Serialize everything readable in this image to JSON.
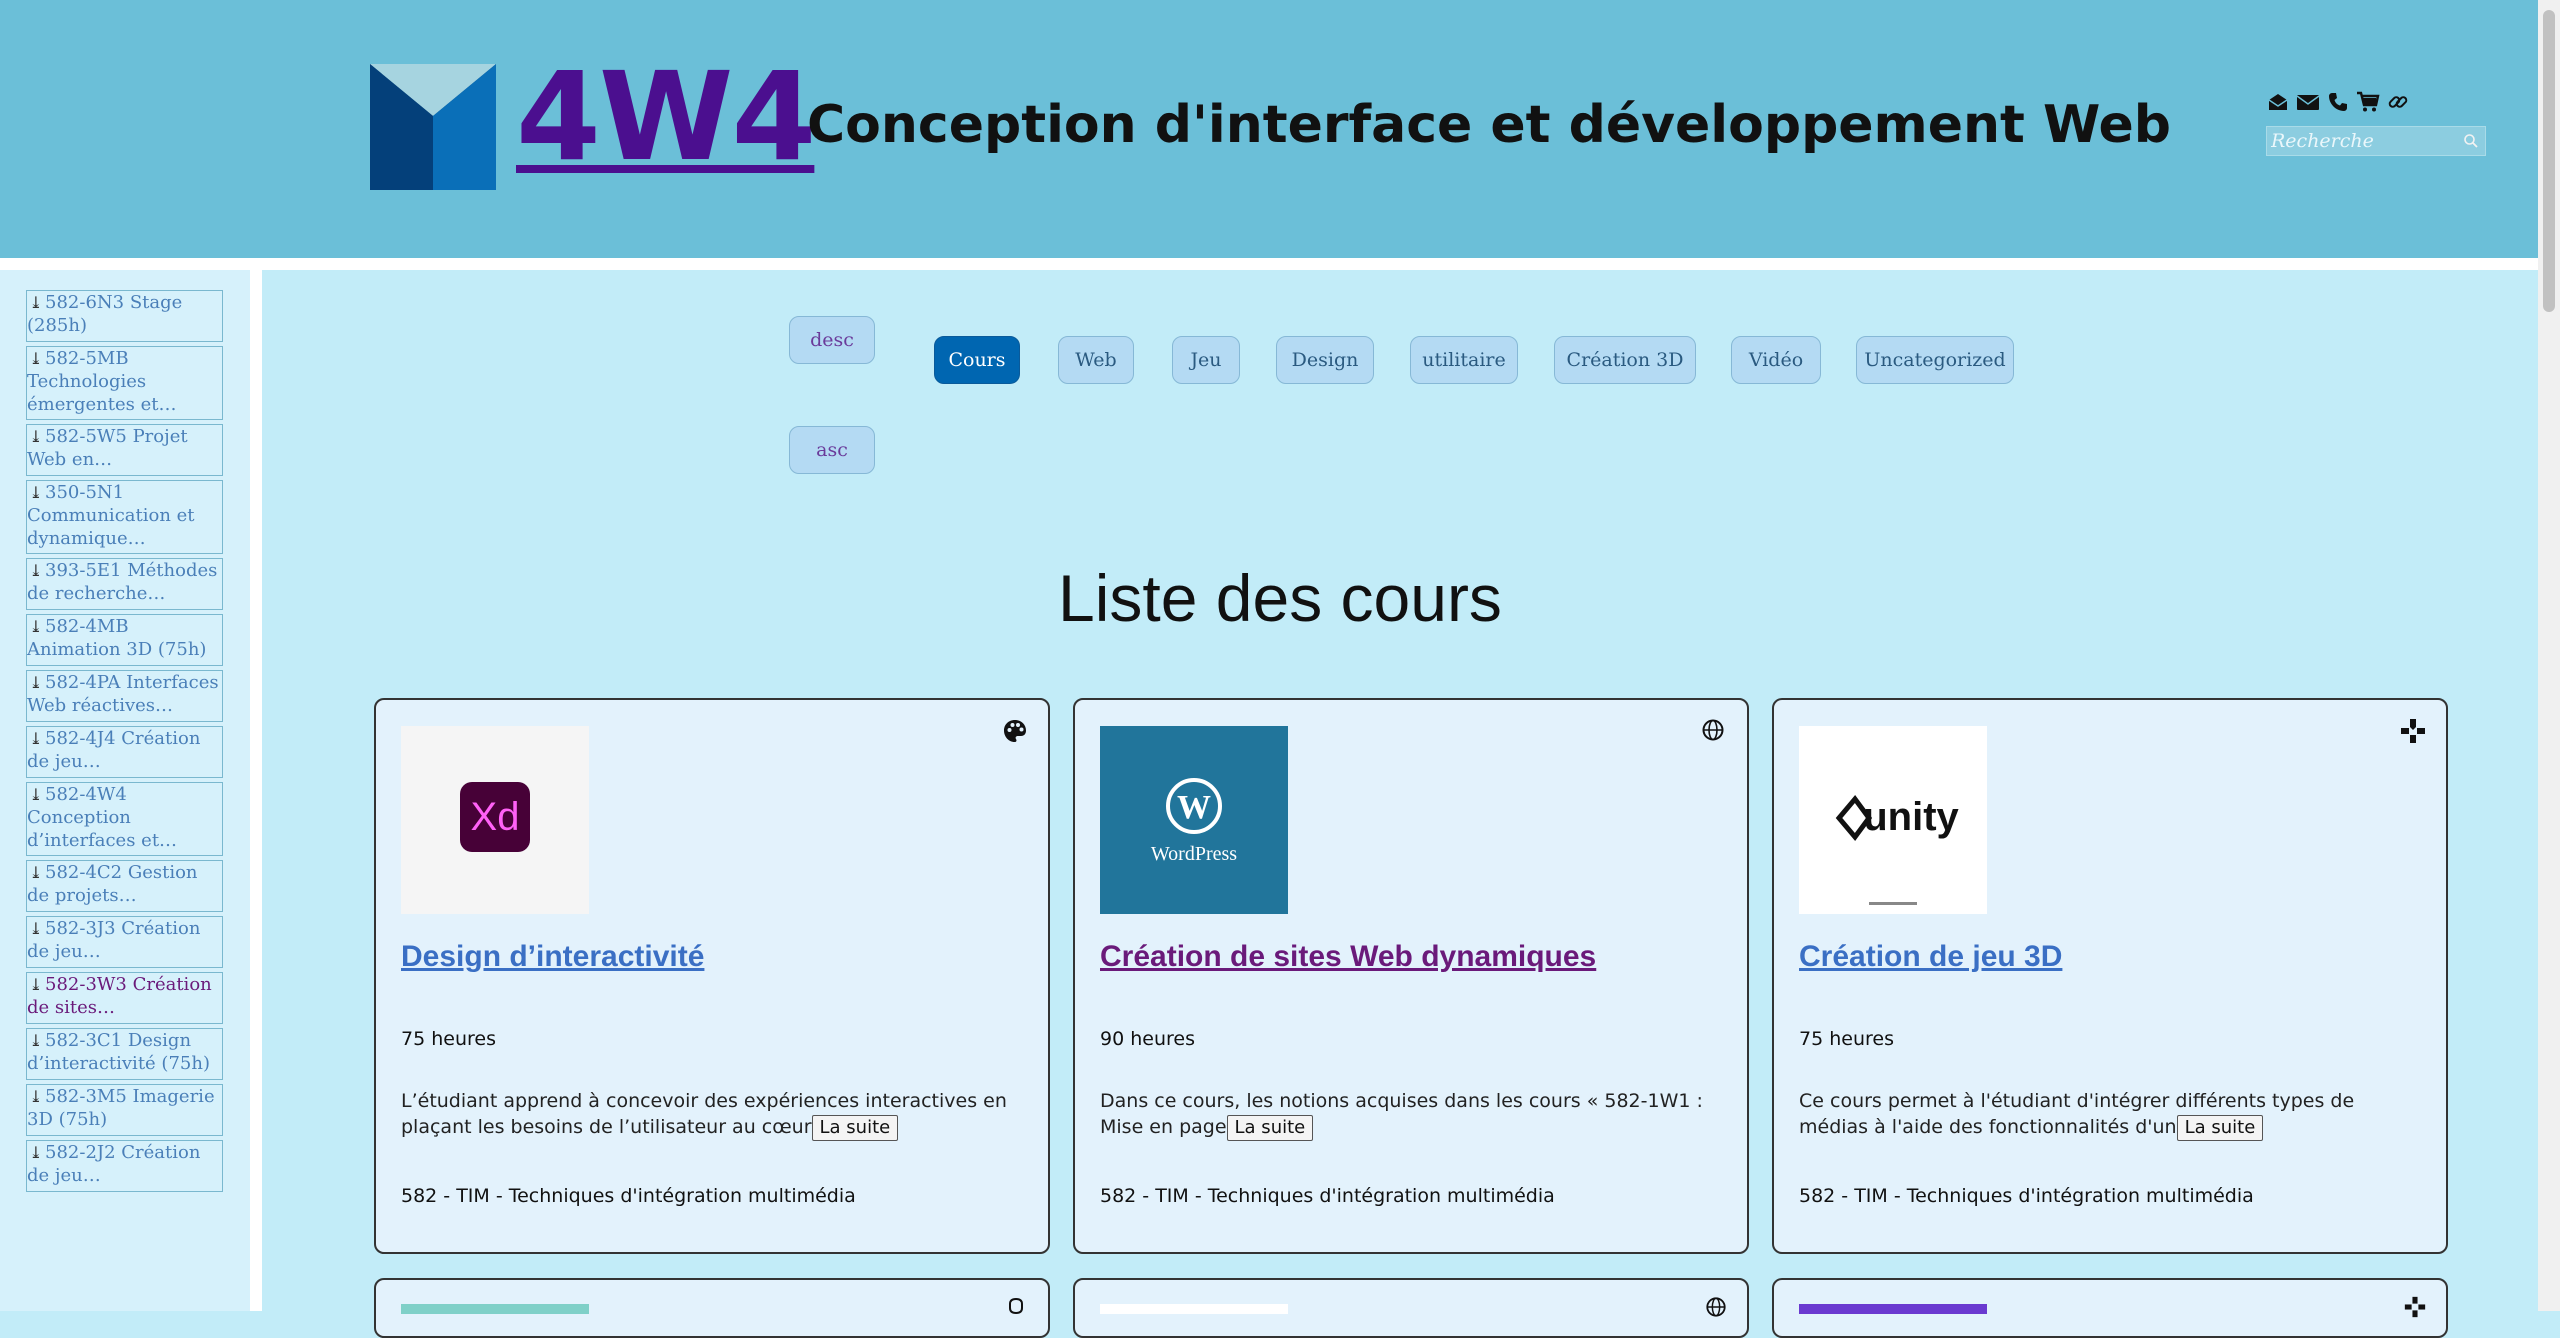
{
  "header": {
    "logo_text": "4W4",
    "site_description": "Conception d'interface et développement Web",
    "icons": [
      "envelope-open-icon",
      "envelope-icon",
      "phone-icon",
      "cart-icon",
      "link-icon"
    ],
    "search_placeholder": "Recherche"
  },
  "sidebar": {
    "items": [
      {
        "label": "582-6N3 Stage (285h)",
        "active": false
      },
      {
        "label": "582-5MB Technologies émergentes et…",
        "active": false
      },
      {
        "label": "582-5W5 Projet Web en…",
        "active": false
      },
      {
        "label": "350-5N1 Communication et dynamique…",
        "active": false
      },
      {
        "label": "393-5E1 Méthodes de recherche…",
        "active": false
      },
      {
        "label": "582-4MB Animation 3D (75h)",
        "active": false
      },
      {
        "label": "582-4PA Interfaces Web réactives…",
        "active": false
      },
      {
        "label": "582-4J4 Création de jeu…",
        "active": false
      },
      {
        "label": "582-4W4 Conception d’interfaces et…",
        "active": false
      },
      {
        "label": "582-4C2 Gestion de projets…",
        "active": false
      },
      {
        "label": "582-3J3 Création de jeu…",
        "active": false
      },
      {
        "label": "582-3W3 Création de sites…",
        "active": true
      },
      {
        "label": "582-3C1 Design d’interactivité (75h)",
        "active": false
      },
      {
        "label": "582-3M5 Imagerie 3D (75h)",
        "active": false
      },
      {
        "label": "582-2J2 Création de jeu…",
        "active": false
      }
    ]
  },
  "sort": {
    "desc": "desc",
    "asc": "asc"
  },
  "categories": [
    {
      "label": "Cours",
      "active": true
    },
    {
      "label": "Web",
      "active": false
    },
    {
      "label": "Jeu",
      "active": false
    },
    {
      "label": "Design",
      "active": false
    },
    {
      "label": "utilitaire",
      "active": false
    },
    {
      "label": "Création 3D",
      "active": false
    },
    {
      "label": "Vidéo",
      "active": false
    },
    {
      "label": "Uncategorized",
      "active": false
    }
  ],
  "page_title": "Liste des cours",
  "more_label": "La suite",
  "cards": [
    {
      "title": "Design d’interactivité",
      "hours": "75 heures",
      "excerpt": "L’étudiant apprend à concevoir des expériences interactives en plaçant les besoins de l’utilisateur au cœur",
      "program": "582 - TIM - Techniques d'intégration multimédia",
      "category_icon": "palette-icon",
      "thumb": "adobe-xd-logo",
      "thumb_text": "Xd",
      "title_color": "#3a6fc4"
    },
    {
      "title": "Création de sites Web dynamiques",
      "hours": "90 heures",
      "excerpt": "Dans ce cours, les notions acquises dans les cours « 582-1W1 : Mise en page",
      "program": "582 - TIM - Techniques d'intégration multimédia",
      "category_icon": "globe-icon",
      "thumb": "wordpress-logo",
      "thumb_text": "WordPress",
      "title_color": "#6a1a7a"
    },
    {
      "title": "Création de jeu 3D",
      "hours": "75 heures",
      "excerpt": "Ce cours permet à l'étudiant d'intégrer différents types de médias à l'aide des fonctionnalités d'un",
      "program": "582 - TIM - Techniques d'intégration multimédia",
      "category_icon": "gamepad-icon",
      "thumb": "unity-logo",
      "thumb_text": "unity",
      "title_color": "#3a6fc4"
    }
  ],
  "next_row_icons": [
    "controller-icon",
    "globe-icon",
    "gamepad-icon"
  ],
  "colors": {
    "header_bg": "#6bbfd8",
    "main_bg": "#c2ecf8",
    "sidebar_bg": "#d6f1fb",
    "logo_text": "#4b0f8f",
    "active_pill": "#0066b1",
    "card_bg": "#e3f2fc"
  }
}
